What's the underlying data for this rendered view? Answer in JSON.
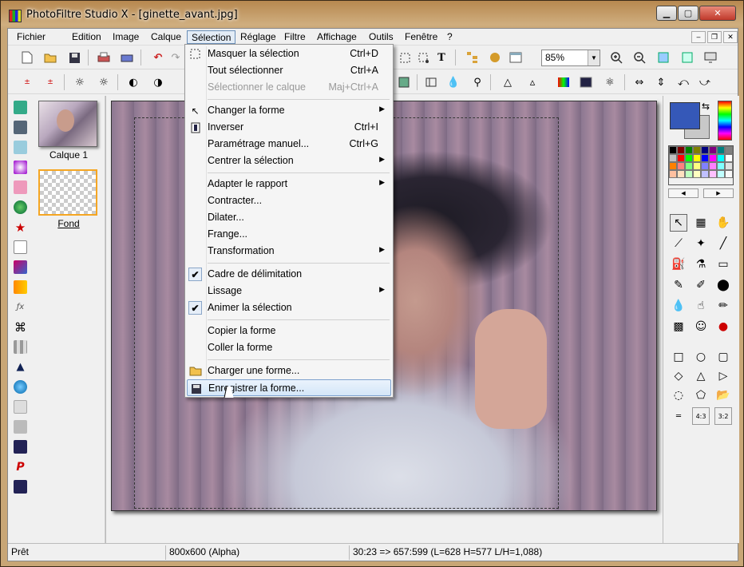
{
  "window": {
    "title": "PhotoFiltre Studio X - [ginette_avant.jpg]",
    "min_glyph": "▁",
    "max_glyph": "▢",
    "close_glyph": "✕"
  },
  "menubar": {
    "items": [
      "Fichier",
      "Edition",
      "Image",
      "Calque",
      "Sélection",
      "Réglage",
      "Filtre",
      "Affichage",
      "Outils",
      "Fenêtre",
      "?"
    ],
    "active": "Sélection",
    "mdi_min": "‒",
    "mdi_restore": "❐",
    "mdi_close": "✕"
  },
  "toolbar": {
    "zoom": "85%",
    "zoom_arrow": "▼"
  },
  "layers": [
    {
      "label": "Calque 1"
    },
    {
      "label": "Fond"
    }
  ],
  "selection_menu": {
    "items": [
      {
        "label": "Masquer la sélection",
        "shortcut": "Ctrl+D",
        "icon": "hide-selection-icon"
      },
      {
        "label": "Tout sélectionner",
        "shortcut": "Ctrl+A"
      },
      {
        "label": "Sélectionner le calque",
        "shortcut": "Maj+Ctrl+A",
        "disabled": true
      },
      {
        "label": "Changer la forme",
        "submenu": true,
        "icon": "pointer-icon"
      },
      {
        "label": "Inverser",
        "shortcut": "Ctrl+I",
        "icon": "invert-icon"
      },
      {
        "label": "Paramétrage manuel...",
        "shortcut": "Ctrl+G"
      },
      {
        "label": "Centrer la sélection",
        "submenu": true
      },
      {
        "label": "Adapter le rapport",
        "submenu": true
      },
      {
        "label": "Contracter..."
      },
      {
        "label": "Dilater..."
      },
      {
        "label": "Frange..."
      },
      {
        "label": "Transformation",
        "submenu": true
      },
      {
        "label": "Cadre de délimitation",
        "checked": true
      },
      {
        "label": "Lissage",
        "submenu": true
      },
      {
        "label": "Animer la sélection",
        "checked": true
      },
      {
        "label": "Copier la forme"
      },
      {
        "label": "Coller la forme"
      },
      {
        "label": "Charger une forme...",
        "icon": "folder-open-icon"
      },
      {
        "label": "Enregistrer la forme...",
        "icon": "save-icon",
        "highlighted": true
      }
    ],
    "submenu_arrow": "▶",
    "check_glyph": "✔"
  },
  "statusbar": {
    "state": "Prêt",
    "image_info": "800x600 (Alpha)",
    "coords": "30:23 => 657:599 (L=628  H=577  L/H=1,088)"
  },
  "colors": {
    "foreground": "#3558b8",
    "background": "#c8c8c8",
    "palette": [
      "#000000",
      "#800000",
      "#008000",
      "#808000",
      "#000080",
      "#800080",
      "#008080",
      "#808080",
      "#c0c0c0",
      "#ff0000",
      "#00ff00",
      "#ffff00",
      "#0000ff",
      "#ff00ff",
      "#00ffff",
      "#ffffff",
      "#ff8000",
      "#ff8080",
      "#80ff80",
      "#ffff80",
      "#8080ff",
      "#ff80ff",
      "#80ffff",
      "#e0e0e0",
      "#ffc0a0",
      "#ffe0c0",
      "#c0ffc0",
      "#ffffc0",
      "#c0c0ff",
      "#ffc0ff",
      "#c0ffff",
      "#f8f8f8"
    ]
  }
}
